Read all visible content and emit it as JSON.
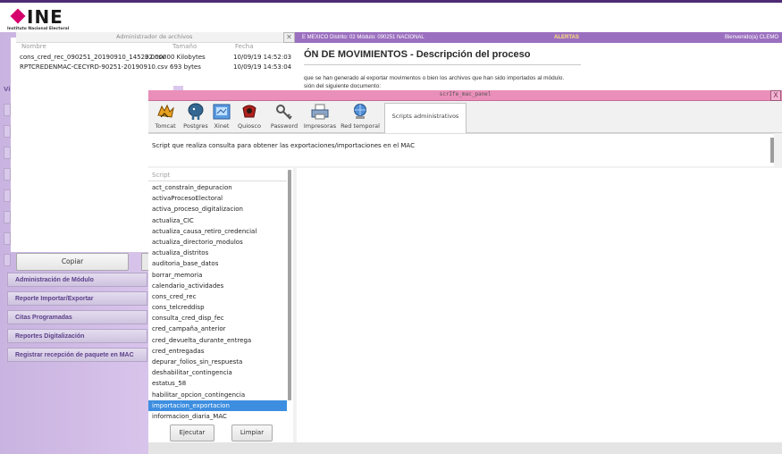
{
  "header": {
    "logo_text": "INE",
    "logo_subtitle": "Instituto Nacional Electoral"
  },
  "top_bar": {
    "district_text": "E MEXICO Distrito: 02 Módulo: 090251 NACIONAL",
    "alerts_label": "ALERTAS",
    "welcome_text": "Bienvenido(a) CLEMO"
  },
  "page": {
    "title": "ÓN DE MOVIMIENTOS - Descripción del proceso",
    "description_line1": "que se han generado al exportar movimentos o bien los archivos que han sido importados al módulo.",
    "description_line2": "sión del siguiente documento:"
  },
  "file_manager": {
    "title": "Administrador de archivos",
    "columns": [
      "Nombre",
      "Tamaño",
      "Fecha"
    ],
    "rows": [
      {
        "name": "cons_cred_rec_090251_20190910_145202.csv",
        "size": "3.000000 Kilobytes",
        "date": "10/09/19 14:52:03"
      },
      {
        "name": "RPTCREDENMAC-CECYRD-90251-20190910.csv",
        "size": "693 bytes",
        "date": "10/09/19 14:53:04"
      }
    ],
    "copy_button": "Copiar"
  },
  "left_nav": {
    "stub_letter": "Vi",
    "items": [
      {
        "label": "Administración de Módulo"
      },
      {
        "label": "Reporte Importar/Exportar"
      },
      {
        "label": "Citas Programadas"
      },
      {
        "label": "Reportes Digitalización"
      },
      {
        "label": "Registrar recepción de paquete en MAC"
      }
    ]
  },
  "script_panel": {
    "window_title": "scrIfe_mac_panel",
    "close_symbol": "X",
    "tabs": [
      {
        "label": "Tomcat",
        "icon": "tomcat-icon"
      },
      {
        "label": "Postgres",
        "icon": "postgres-elephant-icon"
      },
      {
        "label": "Xinet",
        "icon": "xinet-icon"
      },
      {
        "label": "Quiosco",
        "icon": "kiosk-icon"
      },
      {
        "label": "Password",
        "icon": "key-icon"
      },
      {
        "label": "Impresoras",
        "icon": "printer-icon"
      },
      {
        "label": "Red temporal",
        "icon": "network-globe-icon"
      },
      {
        "label": "Scripts administrativos",
        "icon": ""
      }
    ],
    "active_tab": "Scripts administrativos",
    "description": "Script que realiza consulta para obtener las exportaciones/importaciones en el MAC",
    "list_header": "Script",
    "scripts": [
      "act_constrain_depuracion",
      "activaProcesoElectoral",
      "activa_proceso_digitalizacion",
      "actualiza_CIC",
      "actualiza_causa_retiro_credencial",
      "actualiza_directorio_modulos",
      "actualiza_distritos",
      "auditoria_base_datos",
      "borrar_memoria",
      "calendario_actividades",
      "cons_cred_rec",
      "cons_telcreddisp",
      "consulta_cred_disp_fec",
      "cred_campaña_anterior",
      "cred_devuelta_durante_entrega",
      "cred_entregadas",
      "depurar_folios_sin_respuesta",
      "deshabilitar_contingencia",
      "estatus_58",
      "habilitar_opcion_contingencia",
      "importacion_exportacion",
      "informacion_diaria_MAC"
    ],
    "selected_script": "importacion_exportacion",
    "run_button": "Ejecutar",
    "clear_button": "Limpiar"
  },
  "colors": {
    "brand_magenta": "#d6006d",
    "purple_bar": "#9b6fbf",
    "panel_title_pink": "#ea8fb9",
    "selection_blue": "#3d8ee0",
    "left_panel_lavender": "#c9b3e0"
  }
}
